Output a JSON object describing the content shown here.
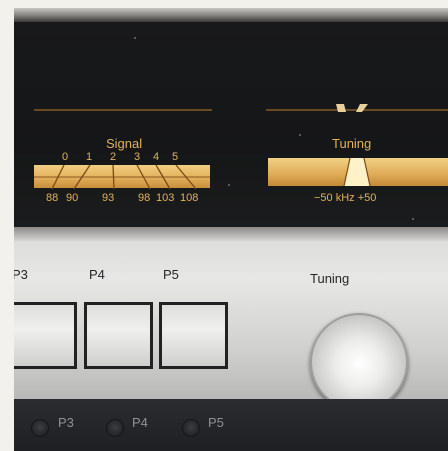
{
  "signal_meter": {
    "title": "Signal",
    "scale_top": [
      "0",
      "1",
      "2",
      "3",
      "4",
      "5"
    ],
    "scale_bottom": [
      "88",
      "90",
      "93",
      "98",
      "103",
      "108"
    ]
  },
  "tuning_meter": {
    "title": "Tuning",
    "scale": "−50 kHz +50"
  },
  "presets": [
    "P3",
    "P4",
    "P5"
  ],
  "knob_label": "Tuning",
  "indicators": [
    "P3",
    "P4",
    "P5"
  ]
}
